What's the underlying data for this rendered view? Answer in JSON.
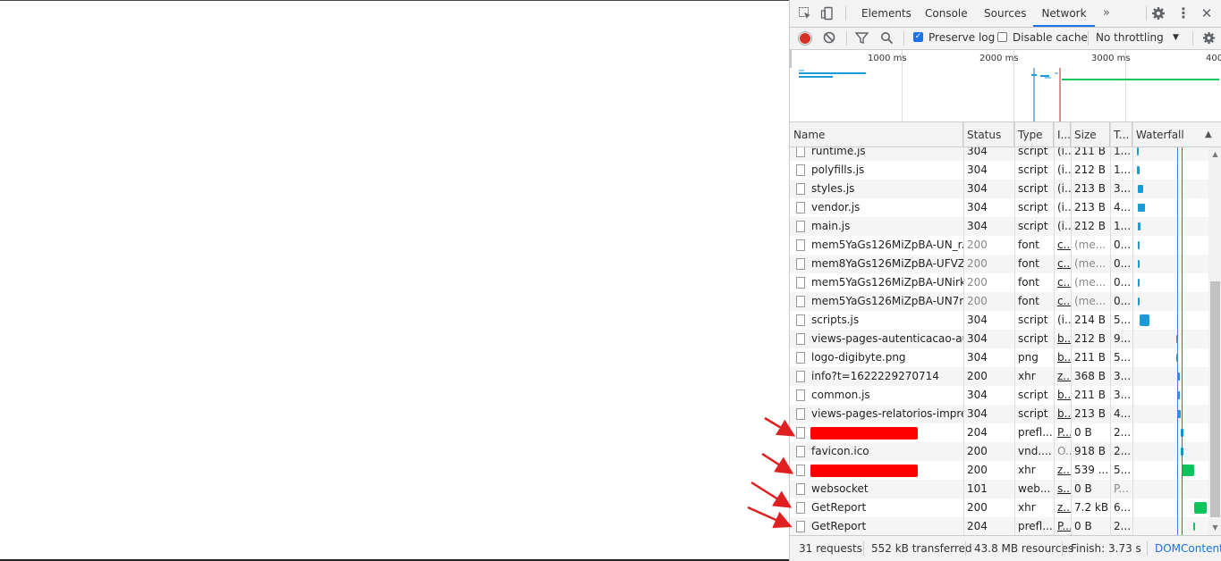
{
  "devtools": {
    "tabs": [
      {
        "label": "Elements"
      },
      {
        "label": "Console"
      },
      {
        "label": "Sources"
      },
      {
        "label": "Network"
      }
    ],
    "more_tabs_icon": "chevron-double-right-icon",
    "toolbar": {
      "preserve_log_label": "Preserve log",
      "preserve_log_checked": true,
      "disable_cache_label": "Disable cache",
      "disable_cache_checked": false,
      "throttling_value": "No throttling"
    },
    "overview": {
      "ticks": [
        "1000 ms",
        "2000 ms",
        "3000 ms",
        "400"
      ]
    },
    "columns": [
      "Name",
      "Status",
      "Type",
      "I...",
      "Size",
      "T...",
      "Waterfall"
    ],
    "rows": [
      {
        "name": "runtime.js",
        "status": "304",
        "type": "script",
        "initiator": "(i...",
        "size": "211 B",
        "time": "1...",
        "wf_color": "#1a9bd7"
      },
      {
        "name": "polyfills.js",
        "status": "304",
        "type": "script",
        "initiator": "(i...",
        "size": "212 B",
        "time": "1...",
        "wf_color": "#1a9bd7"
      },
      {
        "name": "styles.js",
        "status": "304",
        "type": "script",
        "initiator": "(i...",
        "size": "213 B",
        "time": "3...",
        "wf_color": "#1a9bd7"
      },
      {
        "name": "vendor.js",
        "status": "304",
        "type": "script",
        "initiator": "(i...",
        "size": "213 B",
        "time": "4...",
        "wf_color": "#1a9bd7"
      },
      {
        "name": "main.js",
        "status": "304",
        "type": "script",
        "initiator": "(i...",
        "size": "212 B",
        "time": "1...",
        "wf_color": "#1a9bd7"
      },
      {
        "name": "mem5YaGs126MiZpBA-UN_r...",
        "status": "200",
        "type": "font",
        "initiator": "c...",
        "size": "(me...",
        "time": "0...",
        "grey": true,
        "wf_color": "#1a9bd7"
      },
      {
        "name": "mem8YaGs126MiZpBA-UFVZ...",
        "status": "200",
        "type": "font",
        "initiator": "c...",
        "size": "(me...",
        "time": "0...",
        "grey": true,
        "wf_color": "#1a9bd7"
      },
      {
        "name": "mem5YaGs126MiZpBA-UNirk...",
        "status": "200",
        "type": "font",
        "initiator": "c...",
        "size": "(me...",
        "time": "0...",
        "grey": true,
        "wf_color": "#1a9bd7"
      },
      {
        "name": "mem5YaGs126MiZpBA-UN7r...",
        "status": "200",
        "type": "font",
        "initiator": "c...",
        "size": "(me...",
        "time": "0...",
        "grey": true,
        "wf_color": "#1a9bd7"
      },
      {
        "name": "scripts.js",
        "status": "304",
        "type": "script",
        "initiator": "(i...",
        "size": "214 B",
        "time": "5...",
        "wf_color": "#1a9bd7"
      },
      {
        "name": "views-pages-autenticacao-au...",
        "status": "304",
        "type": "script",
        "initiator": "b...",
        "size": "212 B",
        "time": "9...",
        "wf_color": "#1a9bd7"
      },
      {
        "name": "logo-digibyte.png",
        "status": "304",
        "type": "png",
        "initiator": "b...",
        "size": "211 B",
        "time": "5...",
        "wf_color": "#1a9bd7"
      },
      {
        "name": "info?t=1622229270714",
        "status": "200",
        "type": "xhr",
        "initiator": "z...",
        "size": "368 B",
        "time": "3...",
        "wf_color": "#1a9bd7"
      },
      {
        "name": "common.js",
        "status": "304",
        "type": "script",
        "initiator": "b...",
        "size": "211 B",
        "time": "3...",
        "wf_color": "#1a9bd7"
      },
      {
        "name": "views-pages-relatorios-impre...",
        "status": "304",
        "type": "script",
        "initiator": "b...",
        "size": "213 B",
        "time": "4...",
        "wf_color": "#1a9bd7"
      },
      {
        "name": "",
        "redacted": true,
        "status": "204",
        "type": "prefl...",
        "initiator": "P...",
        "size": "0 B",
        "time": "2...",
        "wf_color": "#1a9bd7"
      },
      {
        "name": "favicon.ico",
        "status": "200",
        "type": "vnd....",
        "initiator": "O...",
        "size": "918 B",
        "time": "2...",
        "wf_color": "#1a9bd7"
      },
      {
        "name": "",
        "redacted": true,
        "status": "200",
        "type": "xhr",
        "initiator": "z...",
        "size": "539 ...",
        "time": "5...",
        "wf_color": "#0cc45c"
      },
      {
        "name": "websocket",
        "status": "101",
        "type": "web...",
        "initiator": "s...",
        "size": "0 B",
        "time": "P...",
        "wf_color": ""
      },
      {
        "name": "GetReport",
        "status": "200",
        "type": "xhr",
        "initiator": "z...",
        "size": "7.2 kB",
        "time": "6...",
        "wf_color": "#0cc45c"
      },
      {
        "name": "GetReport",
        "status": "204",
        "type": "prefl...",
        "initiator": "P...",
        "size": "0 B",
        "time": "2...",
        "wf_color": "#0cc45c"
      }
    ],
    "status": {
      "requests": "31 requests",
      "transferred": "552 kB transferred",
      "resources": "43.8 MB resources",
      "finish": "Finish: 3.73 s",
      "domcontent": "DOMContentL"
    },
    "colors": {
      "accent": "#1a73e8",
      "record": "#d93025",
      "redaction": "#ff0000",
      "annotation_arrow": "#e02020"
    }
  }
}
